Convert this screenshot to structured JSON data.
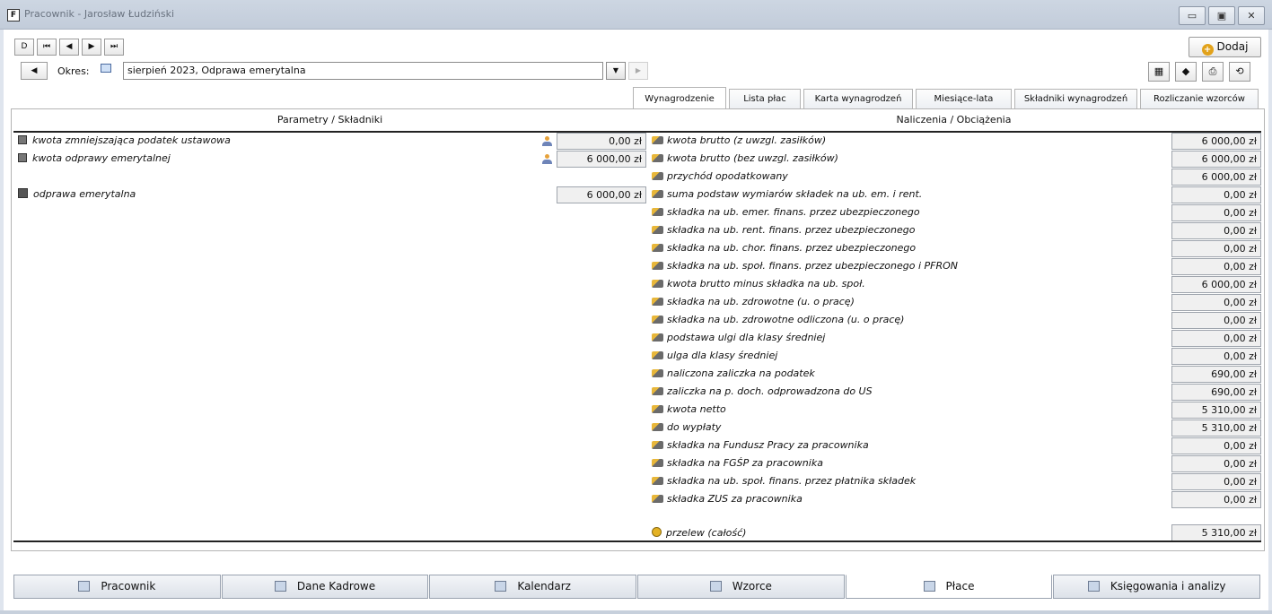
{
  "window": {
    "title": "Pracownik - Jarosław Łudziński",
    "app_icon": "form-icon",
    "controls": [
      "minimize-icon",
      "maximize-icon",
      "close-icon"
    ]
  },
  "nav": {
    "buttons": [
      "D",
      "⏮",
      "◀",
      "▶",
      "⏭"
    ]
  },
  "toolbar": {
    "add_label": "Dodaj"
  },
  "period": {
    "label": "Okres:",
    "value": "sierpień 2023, Odprawa emerytalna"
  },
  "tabs": [
    {
      "label": "Wynagrodzenie",
      "active": true
    },
    {
      "label": "Lista płac"
    },
    {
      "label": "Karta wynagrodzeń"
    },
    {
      "label": "Miesiące-lata"
    },
    {
      "label": "Składniki wynagrodzeń"
    },
    {
      "label": "Rozliczanie wzorców"
    }
  ],
  "left": {
    "header": "Parametry / Składniki",
    "rows": [
      {
        "label": "kwota zmniejszająca podatek ustawowa",
        "value": "0,00 zł"
      },
      {
        "label": "kwota odprawy emerytalnej",
        "value": "6 000,00 zł"
      },
      {
        "label": "odprawa emerytalna",
        "value": "6 000,00 zł"
      }
    ]
  },
  "right": {
    "header": "Naliczenia / Obciążenia",
    "rows": [
      {
        "label": "kwota brutto (z uwzgl. zasiłków)",
        "value": "6 000,00 zł"
      },
      {
        "label": "kwota brutto (bez uwzgl. zasiłków)",
        "value": "6 000,00 zł"
      },
      {
        "label": "przychód opodatkowany",
        "value": "6 000,00 zł"
      },
      {
        "label": "suma podstaw wymiarów składek na ub. em. i rent.",
        "value": "0,00 zł"
      },
      {
        "label": "składka na ub. emer. finans. przez ubezpieczonego",
        "value": "0,00 zł"
      },
      {
        "label": "składka na ub. rent. finans. przez ubezpieczonego",
        "value": "0,00 zł"
      },
      {
        "label": "składka na ub. chor. finans. przez ubezpieczonego",
        "value": "0,00 zł"
      },
      {
        "label": "składka na ub. społ. finans. przez ubezpieczonego i PFRON",
        "value": "0,00 zł"
      },
      {
        "label": "kwota brutto minus składka na ub. społ.",
        "value": "6 000,00 zł"
      },
      {
        "label": "składka na ub. zdrowotne (u. o pracę)",
        "value": "0,00 zł"
      },
      {
        "label": "składka na ub. zdrowotne odliczona (u. o pracę)",
        "value": "0,00 zł"
      },
      {
        "label": "podstawa ulgi dla klasy średniej",
        "value": "0,00 zł"
      },
      {
        "label": "ulga dla klasy średniej",
        "value": "0,00 zł"
      },
      {
        "label": "naliczona zaliczka na podatek",
        "value": "690,00 zł"
      },
      {
        "label": "zaliczka na p. doch. odprowadzona do US",
        "value": "690,00 zł"
      },
      {
        "label": "kwota netto",
        "value": "5 310,00 zł"
      },
      {
        "label": "do wypłaty",
        "value": "5 310,00 zł"
      },
      {
        "label": "składka na Fundusz Pracy za pracownika",
        "value": "0,00 zł"
      },
      {
        "label": "składka na FGŚP za pracownika",
        "value": "0,00 zł"
      },
      {
        "label": "składka na ub. społ. finans. przez płatnika składek",
        "value": "0,00 zł"
      },
      {
        "label": "składka ZUS za pracownika",
        "value": "0,00 zł"
      }
    ],
    "transfer": {
      "label": "przelew (całość)",
      "value": "5 310,00 zł"
    }
  },
  "bottom_tabs": [
    {
      "label": "Pracownik",
      "icon": "person-icon"
    },
    {
      "label": "Dane Kadrowe",
      "icon": "id-card-icon"
    },
    {
      "label": "Kalendarz",
      "icon": "calendar-icon"
    },
    {
      "label": "Wzorce",
      "icon": "people-icon"
    },
    {
      "label": "Płace",
      "icon": "payroll-icon",
      "active": true
    },
    {
      "label": "Księgowania i analizy",
      "icon": "ledger-icon"
    }
  ]
}
